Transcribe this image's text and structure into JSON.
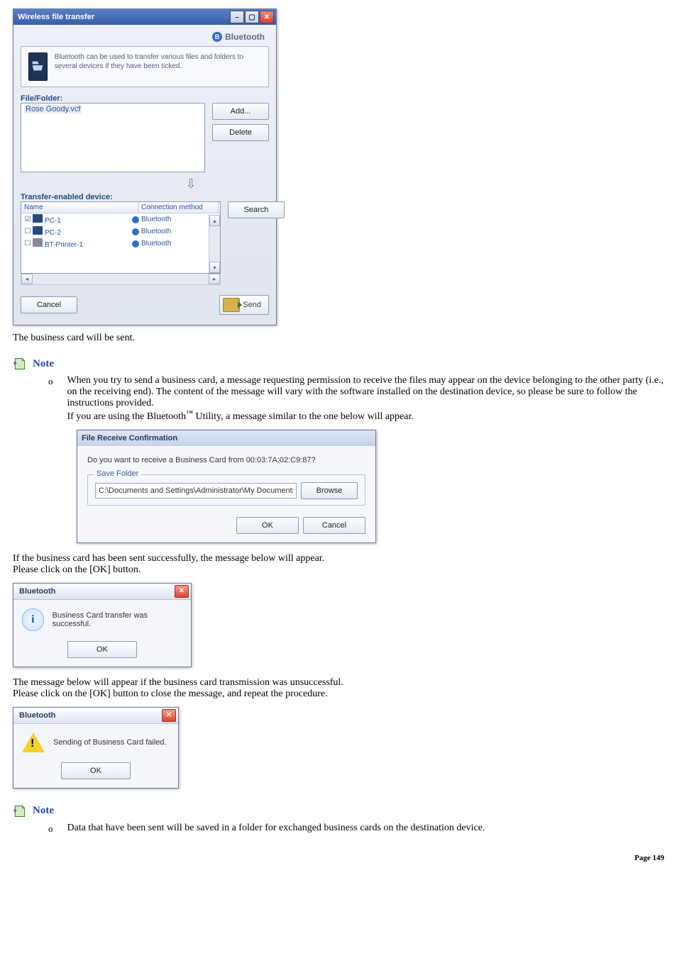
{
  "wft": {
    "title": "Wireless file transfer",
    "brand": "Bluetooth",
    "description": "Bluetooth can be used to transfer various files and folders to several devices if they have been ticked.",
    "file_folder_label": "File/Folder:",
    "file_item": "Rose Goody.vcf",
    "add_btn": "Add...",
    "delete_btn": "Delete",
    "transfer_label": "Transfer-enabled device:",
    "col_name": "Name",
    "col_conn": "Connection method",
    "devices": [
      {
        "name": "PC-1",
        "conn": "Bluetooth",
        "checked": true
      },
      {
        "name": "PC-2",
        "conn": "Bluetooth",
        "checked": false
      },
      {
        "name": "BT-Printer-1",
        "conn": "Bluetooth",
        "checked": false
      }
    ],
    "search_btn": "Search",
    "cancel_btn": "Cancel",
    "send_btn": "Send"
  },
  "para1": "The business card will be sent.",
  "note1": {
    "title": "Note",
    "body1": "When you try to send a business card, a message requesting permission to receive the files may appear on the device belonging to the other party (i.e., on the receiving end). The content of the message will vary with the software installed on the destination device, so please be sure to follow the instructions provided.",
    "body2a": "If you are using the Bluetooth",
    "body2b": "™",
    "body2c": " Utility, a message similar to the one below will appear."
  },
  "frc": {
    "title": "File Receive Confirmation",
    "question": "Do you want to receive a Business Card from 00:03:7A:02:C9:87?",
    "legend": "Save Folder",
    "path": "C:\\Documents and Settings\\Administrator\\My Documents",
    "browse": "Browse",
    "ok": "OK",
    "cancel": "Cancel"
  },
  "para2a": "If the business card has been sent successfully, the message below will appear.",
  "para2b": "Please click on the [OK] button.",
  "msg_success": {
    "title": "Bluetooth",
    "text": "Business Card transfer was successful.",
    "ok": "OK"
  },
  "para3a": "The message below will appear if the business card transmission was unsuccessful.",
  "para3b": "Please click on the [OK] button to close the message, and repeat the procedure.",
  "msg_fail": {
    "title": "Bluetooth",
    "text": "Sending of Business Card failed.",
    "ok": "OK"
  },
  "note2": {
    "title": "Note",
    "body": "Data that have been sent will be saved in a folder for exchanged business cards on the destination device."
  },
  "page_label": "Page 149"
}
